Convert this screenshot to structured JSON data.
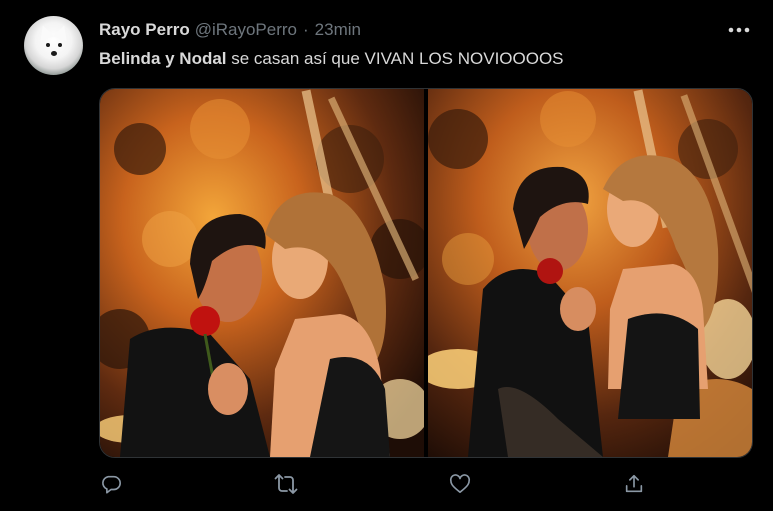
{
  "tweet": {
    "author": {
      "display_name": "Rayo Perro",
      "handle": "@iRayoPerro",
      "avatar_icon": "samoyed-dog-avatar"
    },
    "separator": "·",
    "timestamp": "23min",
    "more_icon": "more-horizontal-icon",
    "text": {
      "bold_part": "Belinda y Nodal",
      "rest": " se casan así que VIVAN LOS NOVIOOOOS"
    },
    "media": {
      "count": 2,
      "photos": [
        {
          "description_icon": "photo-couple-kiss"
        },
        {
          "description_icon": "photo-couple-embrace"
        }
      ]
    },
    "actions": [
      {
        "name": "reply",
        "icon": "reply-icon"
      },
      {
        "name": "retweet",
        "icon": "retweet-icon"
      },
      {
        "name": "like",
        "icon": "like-icon"
      },
      {
        "name": "share",
        "icon": "share-icon"
      }
    ]
  },
  "colors": {
    "background": "#000000",
    "primary_text": "#d9d9d9",
    "secondary_text": "#6e767d",
    "media_border": "#2f3336"
  }
}
